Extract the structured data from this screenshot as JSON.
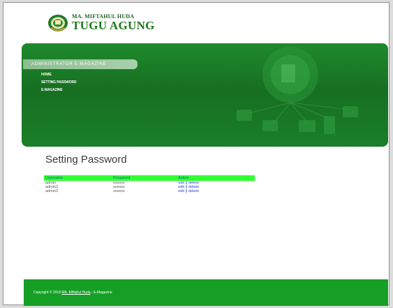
{
  "header": {
    "logo_small": "MA. MIFTAHUL HUDA",
    "logo_big": "TUGU AGUNG"
  },
  "nav": {
    "title": "ADMINISTRATOR E-MAGAZINE",
    "items": [
      "HOME",
      "SETTING PASSWORD",
      "E-MAGAZINE"
    ]
  },
  "content": {
    "title": "Setting Password",
    "columns": [
      "Username",
      "Password",
      "Action"
    ],
    "rows": [
      {
        "username": "admin",
        "password": "xxxxxx",
        "edit": "edit",
        "sep": "||",
        "delete": "delete"
      },
      {
        "username": "admin2",
        "password": "xxxxxx",
        "edit": "edit",
        "sep": "||",
        "delete": "delete"
      },
      {
        "username": "admin3",
        "password": "xxxxxx",
        "edit": "edit",
        "sep": "||",
        "delete": "delete"
      }
    ]
  },
  "footer": {
    "prefix": "Copyright © 2018",
    "link": "MA. Miftahul Huda",
    "suffix": "- E-Magazine"
  },
  "colors": {
    "brand_green": "#1a7a1a",
    "banner_green": "#1a7f28",
    "table_header": "#33ff33",
    "footer_green": "#169f25",
    "link_blue": "#2a3fd0"
  }
}
